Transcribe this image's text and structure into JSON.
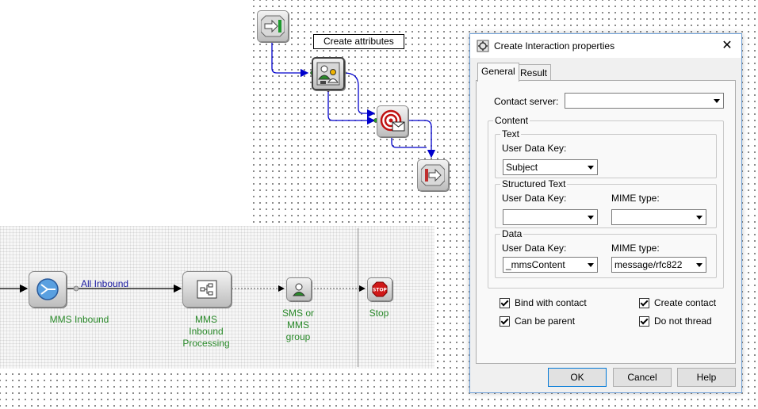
{
  "canvas": {
    "tag_label": "Create attributes",
    "flow_label": "All Inbound",
    "nodes": {
      "mms_inbound": "MMS Inbound",
      "mms_processing": "MMS\nInbound\nProcessing",
      "sms_group": "SMS or\nMMS\ngroup",
      "stop": "Stop",
      "stop_icon_text": "STOP"
    }
  },
  "dialog": {
    "title": "Create Interaction properties",
    "close_glyph": "✕",
    "tabs": [
      {
        "label": "General",
        "active": true
      },
      {
        "label": "Result",
        "active": false
      }
    ],
    "contact_server": {
      "label": "Contact server:",
      "value": ""
    },
    "content": {
      "legend": "Content",
      "text": {
        "legend": "Text",
        "user_data_key_label": "User Data Key:",
        "user_data_key": "Subject"
      },
      "structured_text": {
        "legend": "Structured Text",
        "user_data_key_label": "User Data Key:",
        "user_data_key": "",
        "mime_label": "MIME type:",
        "mime": ""
      },
      "data": {
        "legend": "Data",
        "user_data_key_label": "User Data Key:",
        "user_data_key": "_mmsContent",
        "mime_label": "MIME type:",
        "mime": "message/rfc822"
      }
    },
    "checkboxes": {
      "bind_with_contact": {
        "label": "Bind with contact",
        "checked": true
      },
      "create_contact": {
        "label": "Create contact",
        "checked": true
      },
      "can_be_parent": {
        "label": "Can be parent",
        "checked": true
      },
      "do_not_thread": {
        "label": "Do not thread",
        "checked": true
      }
    },
    "buttons": {
      "ok": "OK",
      "cancel": "Cancel",
      "help": "Help"
    }
  },
  "colors": {
    "flow_line": "#0000cc",
    "label_green": "#2a8a2a",
    "dialog_border": "#6ea0d8"
  }
}
